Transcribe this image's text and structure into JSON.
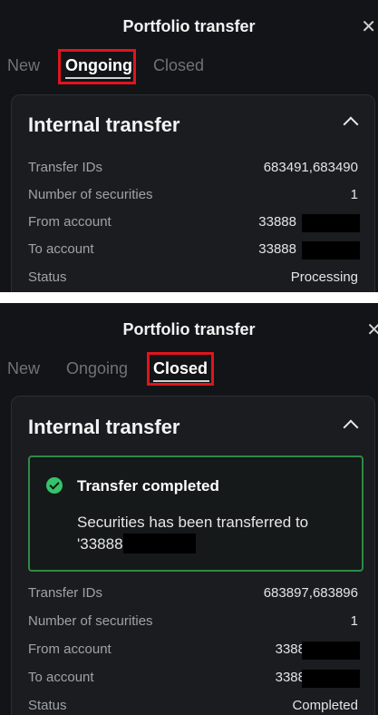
{
  "top": {
    "title": "Portfolio transfer",
    "tabs": [
      "New",
      "Ongoing",
      "Closed"
    ],
    "card": {
      "title": "Internal transfer",
      "rows": [
        {
          "label": "Transfer IDs",
          "value": "683491,683490"
        },
        {
          "label": "Number of securities",
          "value": "1"
        },
        {
          "label": "From account",
          "value": "33888"
        },
        {
          "label": "To account",
          "value": "33888"
        },
        {
          "label": "Status",
          "value": "Processing"
        }
      ]
    }
  },
  "bottom": {
    "title": "Portfolio transfer",
    "tabs": [
      "New",
      "Ongoing",
      "Closed"
    ],
    "card": {
      "title": "Internal transfer",
      "success": {
        "title": "Transfer completed",
        "message_line1": "Securities has been transferred to",
        "message_line2": "'33888"
      },
      "rows": [
        {
          "label": "Transfer IDs",
          "value": "683897,683896"
        },
        {
          "label": "Number of securities",
          "value": "1"
        },
        {
          "label": "From account",
          "value": "3388"
        },
        {
          "label": "To account",
          "value": "3388"
        },
        {
          "label": "Status",
          "value": "Completed"
        }
      ]
    }
  },
  "colors": {
    "background": "#121417",
    "card": "#1a1c20",
    "highlight": "#e0141c",
    "success_border": "#2f8a47",
    "success_icon": "#35c36b"
  },
  "icons": {
    "close": "close-icon",
    "collapse": "chevron-up-icon",
    "success": "check-circle-icon"
  }
}
